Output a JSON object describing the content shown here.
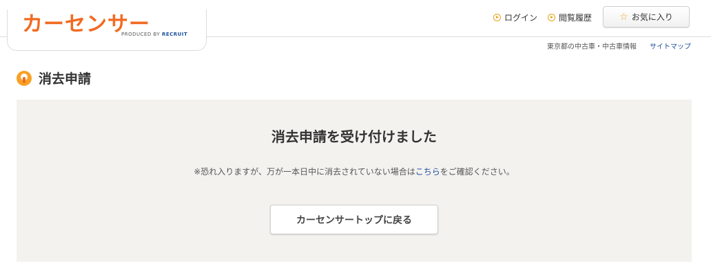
{
  "header": {
    "logo_text": "カーセンサー",
    "logo_sub_prefix": "PRODUCED BY ",
    "logo_sub_brand": "RECRUIT",
    "login_label": "ログイン",
    "history_label": "閲覧履歴",
    "favorites_label": "お気に入り",
    "region_link": "東京都の中古車・中古車情報",
    "sitemap_link": "サイトマップ"
  },
  "page": {
    "title": "消去申請"
  },
  "panel": {
    "heading": "消去申請を受け付けました",
    "note_before": "※恐れ入りますが、万が一本日中に消去されていない場合は",
    "note_link": "こちら",
    "note_after": "をご確認ください。",
    "button_label": "カーセンサートップに戻る"
  },
  "colors": {
    "brand_orange": "#f26a21",
    "accent_yellow": "#e8a317",
    "link_blue": "#1f4e9c",
    "panel_bg": "#f3f2ef"
  }
}
